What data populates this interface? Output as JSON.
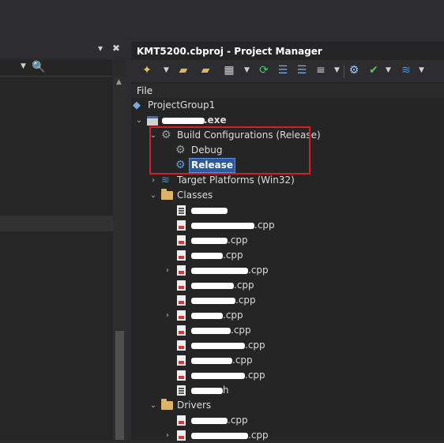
{
  "left_panel": {
    "pin_icon": "▾",
    "close_icon": "✖"
  },
  "project_manager": {
    "title": "KMT5200.cbproj - Project Manager",
    "column_header": "File",
    "tree": {
      "project_group": "ProjectGroup1",
      "project_exe": ".exe",
      "build_configurations": "Build Configurations (Release)",
      "debug": "Debug",
      "release": "Release",
      "target_platforms": "Target Platforms (Win32)",
      "classes_folder": "Classes",
      "classes_files": [
        {
          "label": "",
          "icon": "header"
        },
        {
          "label": ".cpp",
          "icon": "cpp"
        },
        {
          "label": ".cpp",
          "icon": "cpp"
        },
        {
          "label": ".cpp",
          "icon": "cpp"
        },
        {
          "label": ".cpp",
          "icon": "cpp",
          "expandable": true
        },
        {
          "label": ".cpp",
          "icon": "cpp"
        },
        {
          "label": ".cpp",
          "icon": "cpp"
        },
        {
          "label": ".cpp",
          "icon": "cpp",
          "expandable": true
        },
        {
          "label": ".cpp",
          "icon": "cpp"
        },
        {
          "label": ".cpp",
          "icon": "cpp"
        },
        {
          "label": ".cpp",
          "icon": "cpp"
        },
        {
          "label": ".cpp",
          "icon": "cpp"
        },
        {
          "label": "h",
          "icon": "header"
        }
      ],
      "drivers_folder": "Drivers",
      "drivers_files": [
        {
          "label": ".cpp",
          "icon": "cpp"
        },
        {
          "label": ".cpp",
          "icon": "cpp",
          "expandable": true
        }
      ]
    }
  },
  "colors": {
    "background": "#252526",
    "toolbar": "#2d2d30",
    "selection": "#2c5aa0",
    "highlight_box": "#d0202a"
  }
}
